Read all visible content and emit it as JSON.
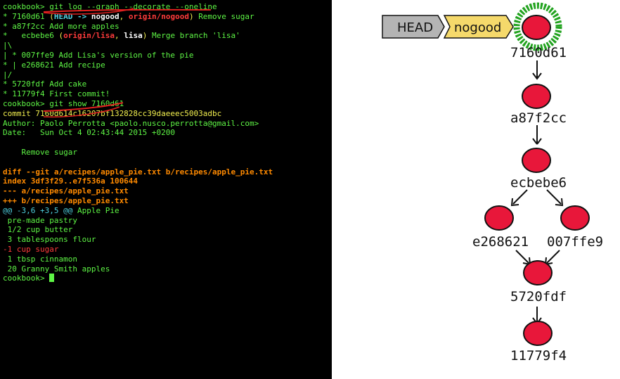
{
  "terminal": {
    "lines": [
      [
        {
          "t": "cookbook> ",
          "c": "g"
        },
        {
          "t": "git log --graph --decorate --oneline",
          "c": "g"
        }
      ],
      [
        {
          "t": "* 7160d61 ",
          "c": "g"
        },
        {
          "t": "(",
          "c": "y"
        },
        {
          "t": "HEAD -> ",
          "c": "c b"
        },
        {
          "t": "nogood",
          "c": "w b"
        },
        {
          "t": ", ",
          "c": "y"
        },
        {
          "t": "origin/nogood",
          "c": "r b"
        },
        {
          "t": ") ",
          "c": "y"
        },
        {
          "t": "Remove sugar",
          "c": "g"
        }
      ],
      [
        {
          "t": "* a87f2cc Add more apples",
          "c": "g"
        }
      ],
      [
        {
          "t": "*   ecbebe6 ",
          "c": "g"
        },
        {
          "t": "(",
          "c": "y"
        },
        {
          "t": "origin/lisa",
          "c": "r b"
        },
        {
          "t": ", ",
          "c": "y"
        },
        {
          "t": "lisa",
          "c": "w b"
        },
        {
          "t": ") ",
          "c": "y"
        },
        {
          "t": "Merge branch 'lisa'",
          "c": "g"
        }
      ],
      [
        {
          "t": "|\\",
          "c": "g"
        }
      ],
      [
        {
          "t": "| ",
          "c": "g"
        },
        {
          "t": "* 007ffe9 Add Lisa's version of the pie",
          "c": "g"
        }
      ],
      [
        {
          "t": "* | e268621 Add recipe",
          "c": "g"
        }
      ],
      [
        {
          "t": "|/",
          "c": "g"
        }
      ],
      [
        {
          "t": "* 5720fdf Add cake",
          "c": "g"
        }
      ],
      [
        {
          "t": "* 11779f4 First commit!",
          "c": "g"
        }
      ],
      [
        {
          "t": "cookbook> ",
          "c": "g"
        },
        {
          "t": "git show 7160d61",
          "c": "g"
        }
      ],
      [
        {
          "t": "commit 7160d614c16207bf132828cc39daeeec5003adbc",
          "c": "y"
        }
      ],
      [
        {
          "t": "Author: Paolo Perrotta <paolo.nusco.perrotta@gmail.com>",
          "c": "g"
        }
      ],
      [
        {
          "t": "Date:   Sun Oct 4 02:43:44 2015 +0200",
          "c": "g"
        }
      ],
      [
        {
          "t": "",
          "c": "g"
        }
      ],
      [
        {
          "t": "    Remove sugar",
          "c": "g"
        }
      ],
      [
        {
          "t": "",
          "c": "g"
        }
      ],
      [
        {
          "t": "diff --git a/recipes/apple_pie.txt b/recipes/apple_pie.txt",
          "c": "o b"
        }
      ],
      [
        {
          "t": "index 3df3f29..e7f536a 100644",
          "c": "o b"
        }
      ],
      [
        {
          "t": "--- a/recipes/apple_pie.txt",
          "c": "o b"
        }
      ],
      [
        {
          "t": "+++ b/recipes/apple_pie.txt",
          "c": "o b"
        }
      ],
      [
        {
          "t": "@@ -3,6 +3,5 @@",
          "c": "c"
        },
        {
          "t": " Apple Pie",
          "c": "g"
        }
      ],
      [
        {
          "t": " pre-made pastry",
          "c": "g"
        }
      ],
      [
        {
          "t": " 1/2 cup butter",
          "c": "g"
        }
      ],
      [
        {
          "t": " 3 tablespoons flour",
          "c": "g"
        }
      ],
      [
        {
          "t": "-1 cup sugar",
          "c": "r"
        }
      ],
      [
        {
          "t": " 1 tbsp cinnamon",
          "c": "g"
        }
      ],
      [
        {
          "t": " 20 Granny Smith apples",
          "c": "g"
        }
      ],
      [
        {
          "t": "cookbook> ",
          "c": "g"
        }
      ]
    ]
  },
  "diagram": {
    "head_label": "HEAD",
    "branch_label": "nogood",
    "commits": {
      "c7160d61": "7160d61",
      "ca87f2cc": "a87f2cc",
      "cecbebe6": "ecbebe6",
      "ce268621": "e268621",
      "c007ffe9": "007ffe9",
      "c5720fdf": "5720fdf",
      "c11779f4": "11779f4"
    },
    "colors": {
      "commit": "#e8173a",
      "highlight": "#22a31f",
      "head_tag": "#b4b4b4",
      "branch_tag": "#f5d96b"
    }
  }
}
